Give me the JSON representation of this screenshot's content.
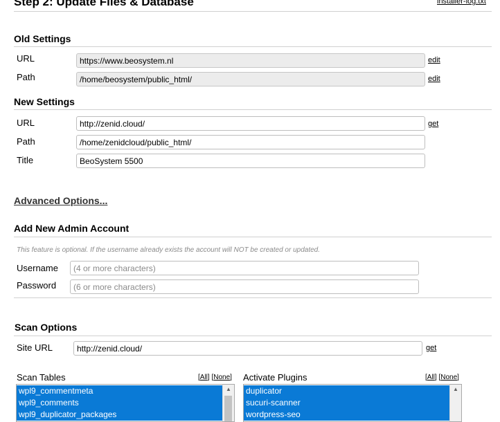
{
  "header": {
    "title": "Step 2: Update Files & Database",
    "log_link": "installer-log.txt"
  },
  "old_settings": {
    "title": "Old Settings",
    "url_label": "URL",
    "url_value": "https://www.beosystem.nl",
    "url_action": "edit",
    "path_label": "Path",
    "path_value": "/home/beosystem/public_html/",
    "path_action": "edit"
  },
  "new_settings": {
    "title": "New Settings",
    "url_label": "URL",
    "url_value": "http://zenid.cloud/",
    "url_action": "get",
    "path_label": "Path",
    "path_value": "/home/zenidcloud/public_html/",
    "title_label": "Title",
    "title_value": "BeoSystem 5500"
  },
  "advanced": {
    "label": "Advanced Options..."
  },
  "admin": {
    "title": "Add New Admin Account",
    "note": "This feature is optional. If the username already exists the account will NOT be created or updated.",
    "username_label": "Username",
    "username_placeholder": "(4 or more characters)",
    "password_label": "Password",
    "password_placeholder": "(6 or more characters)"
  },
  "scan": {
    "title": "Scan Options",
    "site_url_label": "Site URL",
    "site_url_value": "http://zenid.cloud/",
    "site_url_action": "get",
    "tables_label": "Scan Tables",
    "all": "All",
    "none": "None",
    "tables": [
      "wpl9_commentmeta",
      "wpl9_comments",
      "wpl9_duplicator_packages"
    ],
    "plugins_label": "Activate Plugins",
    "plugins": [
      "duplicator",
      "sucuri-scanner",
      "wordpress-seo"
    ]
  },
  "colors": {
    "selection": "#0a7ad6",
    "divider": "#d0d0d0",
    "readonly_bg": "#ececec"
  }
}
